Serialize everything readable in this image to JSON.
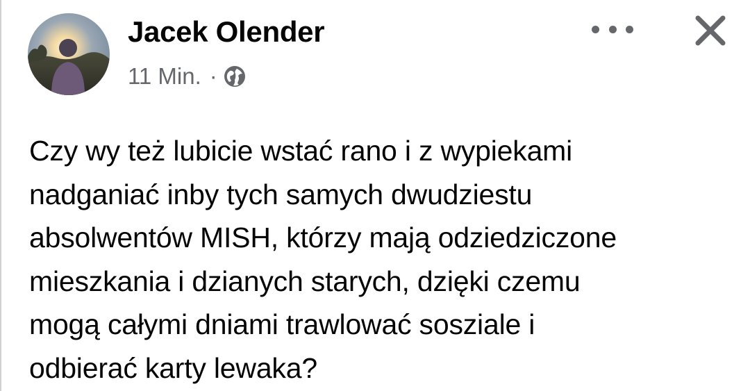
{
  "post": {
    "author_name": "Jacek Olender",
    "timestamp": "11 Min.",
    "separator": "·",
    "privacy_icon": "globe-icon",
    "more_icon": "more-options-icon",
    "close_icon": "close-icon",
    "text": "Czy wy też lubicie wstać rano i z wypiekami\nnadganiać inby tych samych dwudziestu\nabsolwentów MISH, którzy mają odziedziczone\nmieszkania i dzianych starych, dzięki czemu\nmogą całymi dniami trawlować sosziale i\nodbierać karty lewaka?"
  },
  "colors": {
    "text": "#050505",
    "secondary_text": "#65676b",
    "background": "#ffffff"
  }
}
